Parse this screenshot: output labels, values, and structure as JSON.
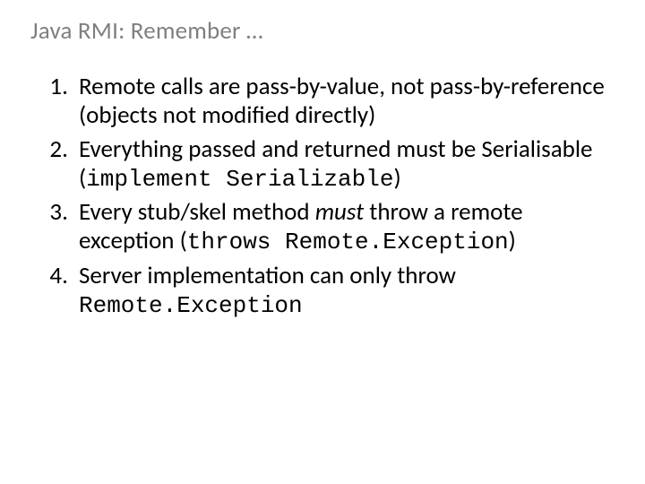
{
  "title": "Java RMI: Remember …",
  "items": {
    "i1a": "Remote calls are pass-by-value, not pass-by-reference (objects not modified directly)",
    "i2a": "Everything passed and returned must be Serialisable (",
    "i2b": "implement Serializable",
    "i2c": ")",
    "i3a": "Every stub/skel method ",
    "i3b": "must",
    "i3c": " throw a remote exception (",
    "i3d": "throws Remote.Exception",
    "i3e": ")",
    "i4a": "Server implementation can only throw",
    "i4b": "Remote.Exception"
  }
}
